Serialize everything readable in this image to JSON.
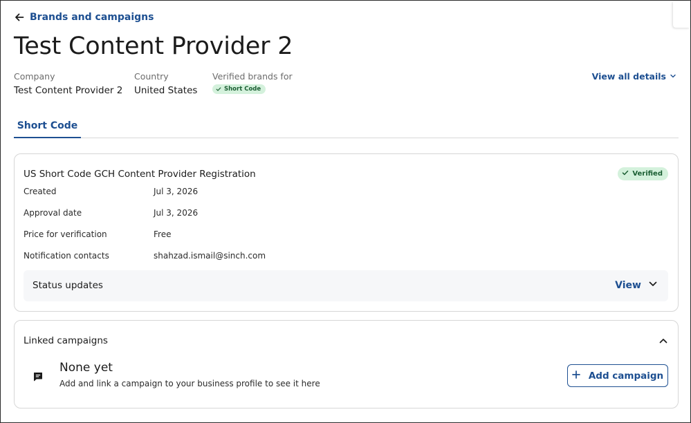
{
  "header": {
    "back_label": "Brands and campaigns",
    "title": "Test Content Provider 2"
  },
  "meta": {
    "company_label": "Company",
    "company_value": "Test Content Provider 2",
    "country_label": "Country",
    "country_value": "United States",
    "verified_label": "Verified brands for",
    "verified_pill": "Short Code",
    "view_all_label": "View all details"
  },
  "tabs": [
    {
      "label": "Short Code",
      "active": true
    }
  ],
  "registration": {
    "title": "US Short Code GCH Content Provider Registration",
    "status": "Verified",
    "rows": [
      {
        "label": "Created",
        "value": "Jul 3, 2026"
      },
      {
        "label": "Approval date",
        "value": "Jul 3, 2026"
      },
      {
        "label": "Price for verification",
        "value": "Free"
      },
      {
        "label": "Notification contacts",
        "value": "shahzad.ismail@sinch.com"
      }
    ],
    "status_updates_label": "Status updates",
    "status_updates_action": "View"
  },
  "linked": {
    "title": "Linked campaigns",
    "empty_title": "None yet",
    "empty_text": "Add and link a campaign to your business profile to see it here",
    "add_label": "Add campaign"
  },
  "colors": {
    "accent": "#1d4f91",
    "success_bg": "#d4f1dc",
    "success_text": "#1b5e33",
    "border": "#d6d6d6"
  },
  "icons": {
    "back": "arrow-left-icon",
    "check": "check-icon",
    "chevron_down": "chevron-down-icon",
    "chevron_up": "chevron-up-icon",
    "chat": "chat-bubble-icon",
    "plus": "plus-icon"
  }
}
